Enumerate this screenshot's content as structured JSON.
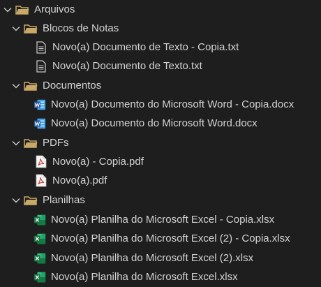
{
  "colors": {
    "background": "#1e1e1e",
    "text": "#d4d4d4",
    "folder": "#c8a968",
    "word": "#2b5797",
    "excel": "#1e7145",
    "pdf": "#c0392b"
  },
  "tree": {
    "root": {
      "label": "Arquivos",
      "icon": "folder-open-icon",
      "expanded": true
    },
    "folders": [
      {
        "label": "Blocos de Notas",
        "icon": "folder-open-icon",
        "expanded": true,
        "files": [
          {
            "label": "Novo(a) Documento de Texto - Copia.txt",
            "icon": "text-file-icon"
          },
          {
            "label": "Novo(a) Documento de Texto.txt",
            "icon": "text-file-icon"
          }
        ]
      },
      {
        "label": "Documentos",
        "icon": "folder-open-icon",
        "expanded": true,
        "files": [
          {
            "label": "Novo(a) Documento do Microsoft Word - Copia.docx",
            "icon": "word-file-icon"
          },
          {
            "label": "Novo(a) Documento do Microsoft Word.docx",
            "icon": "word-file-icon"
          }
        ]
      },
      {
        "label": "PDFs",
        "icon": "folder-open-icon",
        "expanded": true,
        "files": [
          {
            "label": "Novo(a) - Copia.pdf",
            "icon": "pdf-file-icon"
          },
          {
            "label": "Novo(a).pdf",
            "icon": "pdf-file-icon"
          }
        ]
      },
      {
        "label": "Planilhas",
        "icon": "folder-open-icon",
        "expanded": true,
        "files": [
          {
            "label": "Novo(a) Planilha do Microsoft Excel - Copia.xlsx",
            "icon": "excel-file-icon"
          },
          {
            "label": "Novo(a) Planilha do Microsoft Excel (2) - Copia.xlsx",
            "icon": "excel-file-icon"
          },
          {
            "label": "Novo(a) Planilha do Microsoft Excel (2).xlsx",
            "icon": "excel-file-icon"
          },
          {
            "label": "Novo(a) Planilha do Microsoft Excel.xlsx",
            "icon": "excel-file-icon"
          }
        ]
      }
    ]
  }
}
